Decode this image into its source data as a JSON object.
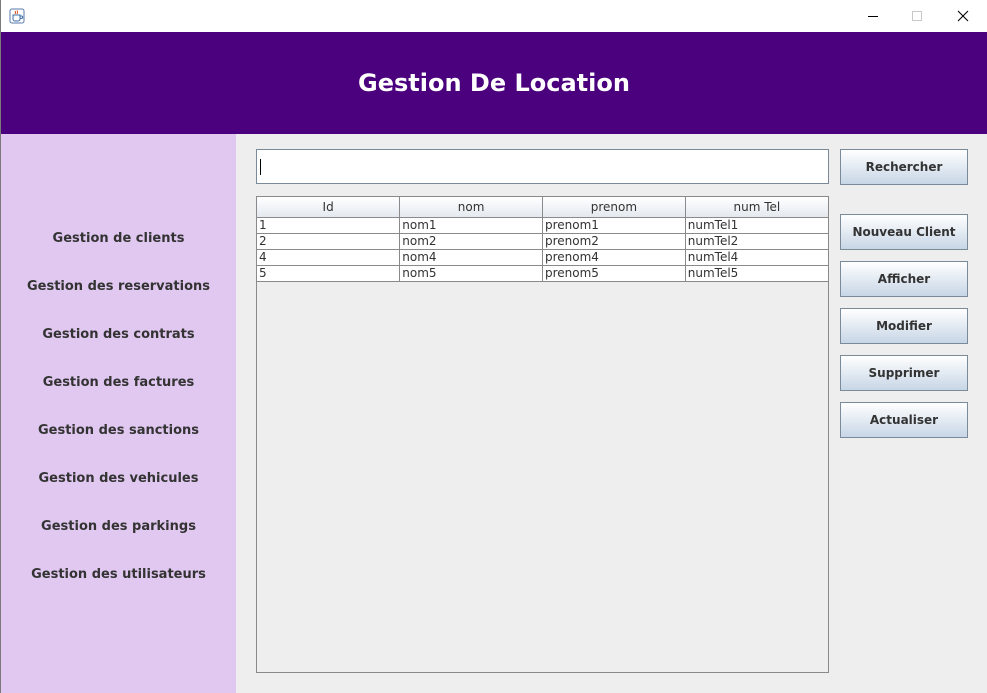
{
  "window": {
    "icon": "java-cup-icon",
    "controls": {
      "minimize": "minimize-icon",
      "maximize": "maximize-icon",
      "close": "close-icon"
    }
  },
  "header": {
    "title": "Gestion De Location",
    "background": "#4b007d"
  },
  "sidebar": {
    "background": "#e1c8f0",
    "items": [
      {
        "label": "Gestion de clients"
      },
      {
        "label": "Gestion des reservations"
      },
      {
        "label": "Gestion des contrats"
      },
      {
        "label": "Gestion des factures"
      },
      {
        "label": "Gestion des sanctions"
      },
      {
        "label": "Gestion des vehicules"
      },
      {
        "label": "Gestion des parkings"
      },
      {
        "label": "Gestion des utilisateurs"
      }
    ]
  },
  "search": {
    "value": "",
    "button_label": "Rechercher"
  },
  "actions": {
    "new_client": "Nouveau Client",
    "show": "Afficher",
    "edit": "Modifier",
    "delete": "Supprimer",
    "refresh": "Actualiser"
  },
  "table": {
    "columns": [
      "Id",
      "nom",
      "prenom",
      "num Tel"
    ],
    "rows": [
      [
        "1",
        "nom1",
        "prenom1",
        "numTel1"
      ],
      [
        "2",
        "nom2",
        "prenom2",
        "numTel2"
      ],
      [
        "4",
        "nom4",
        "prenom4",
        "numTel4"
      ],
      [
        "5",
        "nom5",
        "prenom5",
        "numTel5"
      ]
    ]
  }
}
